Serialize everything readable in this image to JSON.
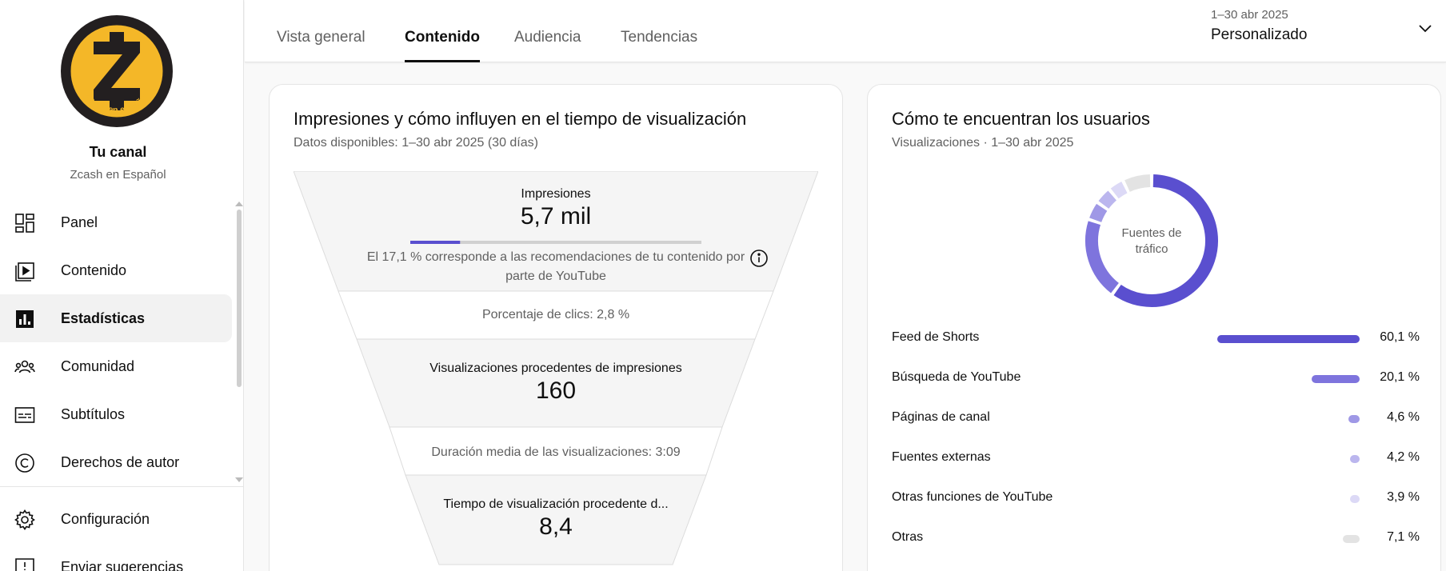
{
  "sidebar": {
    "channel_title": "Tu canal",
    "channel_name": "Zcash en Español",
    "avatar_text": "Zcash en español",
    "items": [
      {
        "label": "Panel",
        "icon": "dashboard-icon"
      },
      {
        "label": "Contenido",
        "icon": "content-icon"
      },
      {
        "label": "Estadísticas",
        "icon": "analytics-icon",
        "active": true
      },
      {
        "label": "Comunidad",
        "icon": "community-icon"
      },
      {
        "label": "Subtítulos",
        "icon": "subtitles-icon"
      },
      {
        "label": "Derechos de autor",
        "icon": "copyright-icon"
      }
    ],
    "bottom_items": [
      {
        "label": "Configuración",
        "icon": "gear-icon"
      },
      {
        "label": "Enviar sugerencias",
        "icon": "feedback-icon"
      }
    ]
  },
  "tabs": [
    {
      "label": "Vista general"
    },
    {
      "label": "Contenido",
      "active": true
    },
    {
      "label": "Audiencia"
    },
    {
      "label": "Tendencias"
    }
  ],
  "date_range": {
    "range": "1–30 abr 2025",
    "label": "Personalizado"
  },
  "impressions_card": {
    "title": "Impresiones y cómo influyen en el tiempo de visualización",
    "subtitle": "Datos disponibles: 1–30 abr 2025 (30 días)",
    "impressions_label": "Impresiones",
    "impressions_value": "5,7 mil",
    "impressions_recommended_fraction": 0.171,
    "impressions_note_line1": "El 17,1 % corresponde a las recomendaciones de tu contenido por",
    "impressions_note_line2": "parte de YouTube",
    "ctr": "Porcentaje de clics: 2,8 %",
    "views_label": "Visualizaciones procedentes de impresiones",
    "views_value": "160",
    "avg_duration": "Duración media de las visualizaciones: 3:09",
    "watch_time_label": "Tiempo de visualización procedente d...",
    "watch_time_value": "8,4"
  },
  "traffic_card": {
    "title": "Cómo te encuentran los usuarios",
    "subtitle": "Visualizaciones · 1–30 abr 2025",
    "donut_label_line1": "Fuentes de",
    "donut_label_line2": "tráfico",
    "sources": [
      {
        "name": "Feed de Shorts",
        "percent": 60.1,
        "label": "60,1 %",
        "color": "#5a4fcf"
      },
      {
        "name": "Búsqueda de YouTube",
        "percent": 20.1,
        "label": "20,1 %",
        "color": "#7e74dd"
      },
      {
        "name": "Páginas de canal",
        "percent": 4.6,
        "label": "4,6 %",
        "color": "#9f98e6"
      },
      {
        "name": "Fuentes externas",
        "percent": 4.2,
        "label": "4,2 %",
        "color": "#bbb6ee"
      },
      {
        "name": "Otras funciones de YouTube",
        "percent": 3.9,
        "label": "3,9 %",
        "color": "#dcd9f6"
      },
      {
        "name": "Otras",
        "percent": 7.1,
        "label": "7,1 %",
        "color": "#e3e3e3"
      }
    ]
  }
}
